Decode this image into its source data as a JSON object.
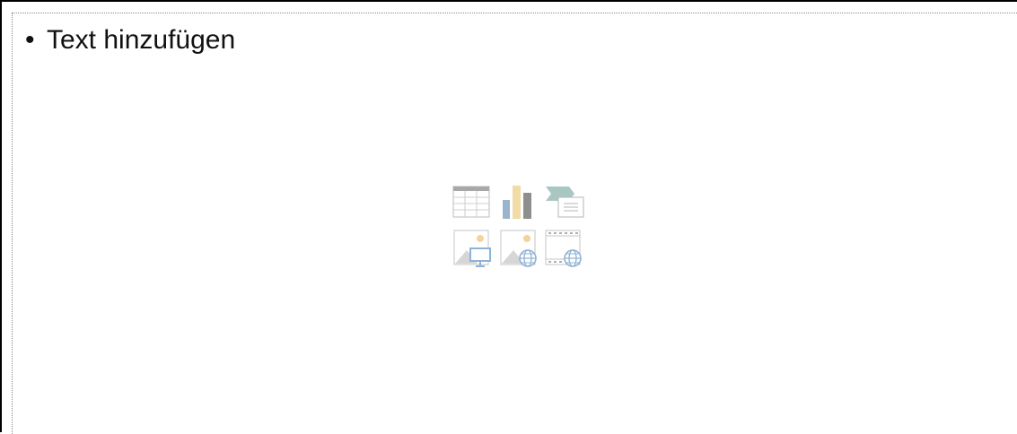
{
  "placeholder": {
    "bullet": "•",
    "text": "Text hinzufügen"
  },
  "insert_icons": [
    {
      "name": "table-icon"
    },
    {
      "name": "chart-icon"
    },
    {
      "name": "smartart-icon"
    },
    {
      "name": "pictures-icon"
    },
    {
      "name": "online-pictures-icon"
    },
    {
      "name": "video-icon"
    }
  ],
  "colors": {
    "icon_gray": "#9a9a9a",
    "icon_light": "#d9d9d9",
    "bar_blue": "#9ab3cf",
    "bar_yellow": "#f1dba6",
    "accent_green": "#a9c6c1",
    "accent_blue": "#8fb3d6",
    "accent_yellow": "#f3d49b"
  }
}
